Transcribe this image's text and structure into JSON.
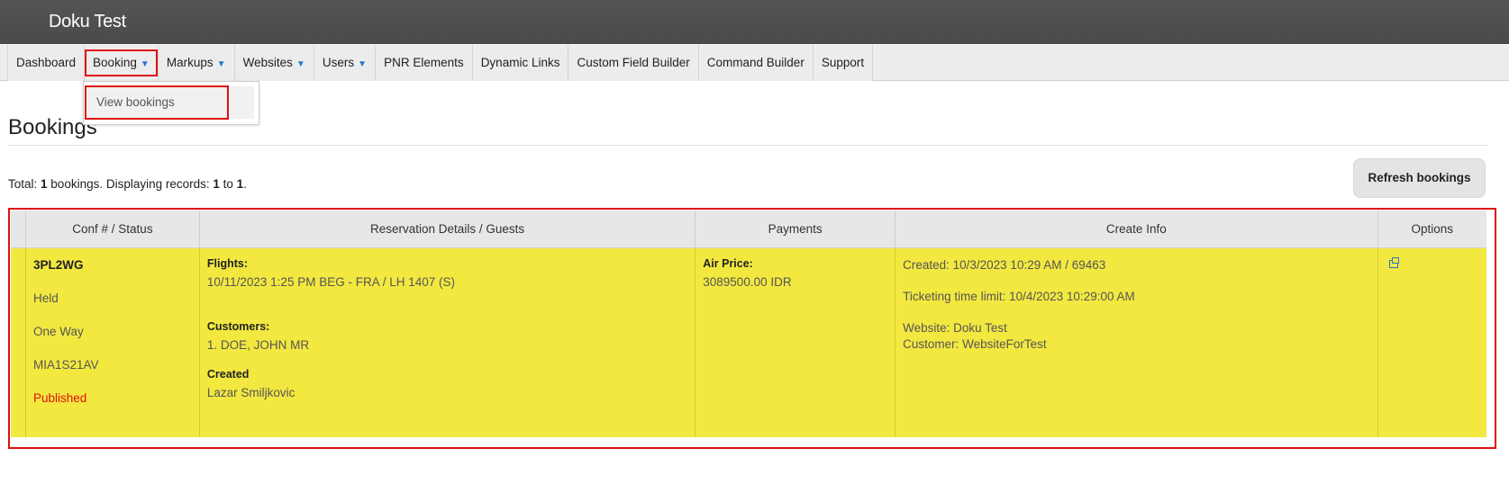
{
  "app": {
    "title": "Doku Test"
  },
  "nav": {
    "items": [
      {
        "label": "Dashboard",
        "dropdown": false
      },
      {
        "label": "Booking",
        "dropdown": true
      },
      {
        "label": "Markups",
        "dropdown": true
      },
      {
        "label": "Websites",
        "dropdown": true
      },
      {
        "label": "Users",
        "dropdown": true
      },
      {
        "label": "PNR Elements",
        "dropdown": false
      },
      {
        "label": "Dynamic Links",
        "dropdown": false
      },
      {
        "label": "Custom Field Builder",
        "dropdown": false
      },
      {
        "label": "Command Builder",
        "dropdown": false
      },
      {
        "label": "Support",
        "dropdown": false
      }
    ],
    "booking_menu": {
      "view_bookings": "View bookings"
    }
  },
  "page": {
    "title": "Bookings",
    "summary": {
      "pre": "Total: ",
      "total": "1",
      "mid": " bookings. Displaying records: ",
      "from": "1",
      "to_word": " to ",
      "to": "1",
      "end": "."
    },
    "refresh_label": "Refresh bookings"
  },
  "table": {
    "headers": {
      "conf": "Conf # / Status",
      "res": "Reservation Details / Guests",
      "pay": "Payments",
      "create": "Create Info",
      "opt": "Options"
    },
    "row": {
      "conf_code": "3PL2WG",
      "status": "Held",
      "trip_type": "One Way",
      "pcc": "MIA1S21AV",
      "publish_status": "Published",
      "flights_label": "Flights:",
      "flight": "10/11/2023  1:25 PM BEG - FRA / LH 1407 (S)",
      "customers_label": "Customers:",
      "customer": "1. DOE, JOHN MR",
      "created_label": "Created",
      "created_by": "Lazar Smiljkovic",
      "air_price_label": "Air Price:",
      "air_price": "3089500.00 IDR",
      "created_info": "Created: 10/3/2023 10:29 AM / 69463",
      "ticketing": "Ticketing time limit: 10/4/2023 10:29:00 AM",
      "website": "Website: Doku Test",
      "customer_info": "Customer: WebsiteForTest",
      "option_icon": "open-in-new-window-icon"
    }
  },
  "colors": {
    "row_highlight": "#f2e840",
    "annotation": "#e01010",
    "accent": "#2a74c9",
    "published": "#e01010"
  }
}
